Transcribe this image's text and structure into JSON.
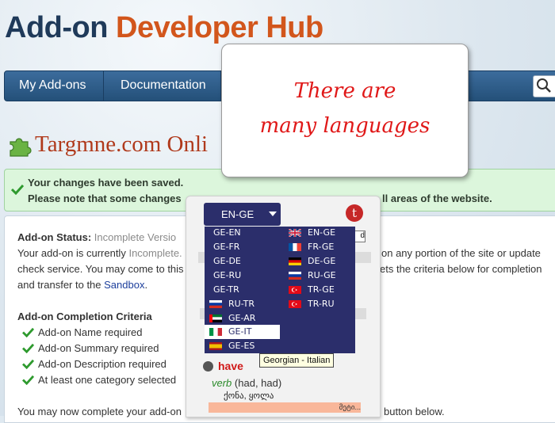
{
  "header": {
    "title_part1": "Add-on",
    "title_part2": "Developer Hub"
  },
  "nav": {
    "items": [
      "My Add-ons",
      "Documentation"
    ]
  },
  "page": {
    "title": "Targmne.com Onli"
  },
  "notice": {
    "line1": "Your changes have been saved.",
    "line2_start": "Please note that some changes",
    "line2_end": "ll areas of the website."
  },
  "status": {
    "label": "Add-on Status:",
    "value": "Incomplete Versio",
    "line1_start": "Your add-on is currently",
    "line1_value": "Incomplete.",
    "line1_end": "on any portion of the site or update",
    "line2_start": "check service. You may come to this",
    "line2_end": "ets the criteria below for completion",
    "line3_start": "and transfer to the",
    "line3_link": "Sandbox",
    "line3_end": "."
  },
  "criteria": {
    "heading": "Add-on Completion Criteria",
    "items": [
      "Add-on Name required",
      "Add-on Summary required",
      "Add-on Description required",
      "At least one category selected"
    ]
  },
  "footer": {
    "start": "You may now complete your add-on",
    "end": "button below."
  },
  "callout": {
    "line1": "There are",
    "line2": "many languages"
  },
  "translator": {
    "selected": "EN-GE",
    "logo": "t",
    "mini_field": "d",
    "left_options": [
      {
        "code": "GE-EN",
        "flag": ""
      },
      {
        "code": "GE-FR",
        "flag": ""
      },
      {
        "code": "GE-DE",
        "flag": ""
      },
      {
        "code": "GE-RU",
        "flag": ""
      },
      {
        "code": "GE-TR",
        "flag": ""
      },
      {
        "code": "RU-TR",
        "flag": "ru"
      },
      {
        "code": "GE-AR",
        "flag": "ae"
      },
      {
        "code": "GE-IT",
        "flag": "it"
      },
      {
        "code": "GE-ES",
        "flag": "es"
      }
    ],
    "right_options": [
      {
        "code": "EN-GE",
        "flag": "gb"
      },
      {
        "code": "FR-GE",
        "flag": "fr"
      },
      {
        "code": "DE-GE",
        "flag": "de"
      },
      {
        "code": "RU-GE",
        "flag": "ru"
      },
      {
        "code": "TR-GE",
        "flag": "tr"
      },
      {
        "code": "TR-RU",
        "flag": "tr"
      }
    ],
    "highlighted": "GE-IT",
    "tooltip": "Georgian - Italian",
    "word": "have",
    "pos": "verb",
    "forms": "(had, had)",
    "translation": "ქონა, ყოლა",
    "bar_text": "მეტი..."
  },
  "colors": {
    "accent": "#d2561c",
    "nav": "#245079",
    "dropdown": "#2b2e6b",
    "callout_text": "#e01818"
  }
}
